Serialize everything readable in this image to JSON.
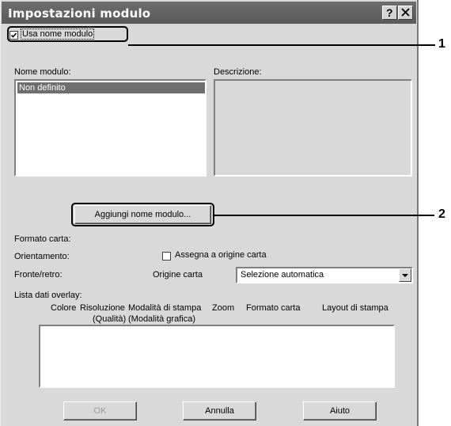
{
  "window": {
    "title": "Impostazioni modulo",
    "help_glyph": "?",
    "close_glyph": "×"
  },
  "use_form_name": {
    "label": "Usa nome modulo",
    "checked": true
  },
  "form_name": {
    "label": "Nome modulo:",
    "items": [
      "Non definito"
    ]
  },
  "description": {
    "label": "Descrizione:"
  },
  "add_form_button": "Aggiungi nome modulo...",
  "paper_size": {
    "label": "Formato carta:"
  },
  "orientation": {
    "label": "Orientamento:"
  },
  "assign_source": {
    "label": "Assegna a origine carta",
    "checked": false
  },
  "duplex": {
    "label": "Fronte/retro:"
  },
  "paper_source": {
    "label": "Origine carta",
    "value": "Selezione automatica"
  },
  "overlay_list": {
    "label": "Lista dati overlay:",
    "columns": [
      {
        "line1": "Colore",
        "line2": ""
      },
      {
        "line1": "Risoluzione",
        "line2": "(Qualità)"
      },
      {
        "line1": "Modalità di stampa",
        "line2": "(Modalità grafica)"
      },
      {
        "line1": "Zoom",
        "line2": ""
      },
      {
        "line1": "Formato carta",
        "line2": ""
      },
      {
        "line1": "Layout di stampa",
        "line2": ""
      }
    ]
  },
  "buttons": {
    "ok": "OK",
    "cancel": "Annulla",
    "help": "Aiuto"
  },
  "callouts": {
    "one": "1",
    "two": "2"
  }
}
